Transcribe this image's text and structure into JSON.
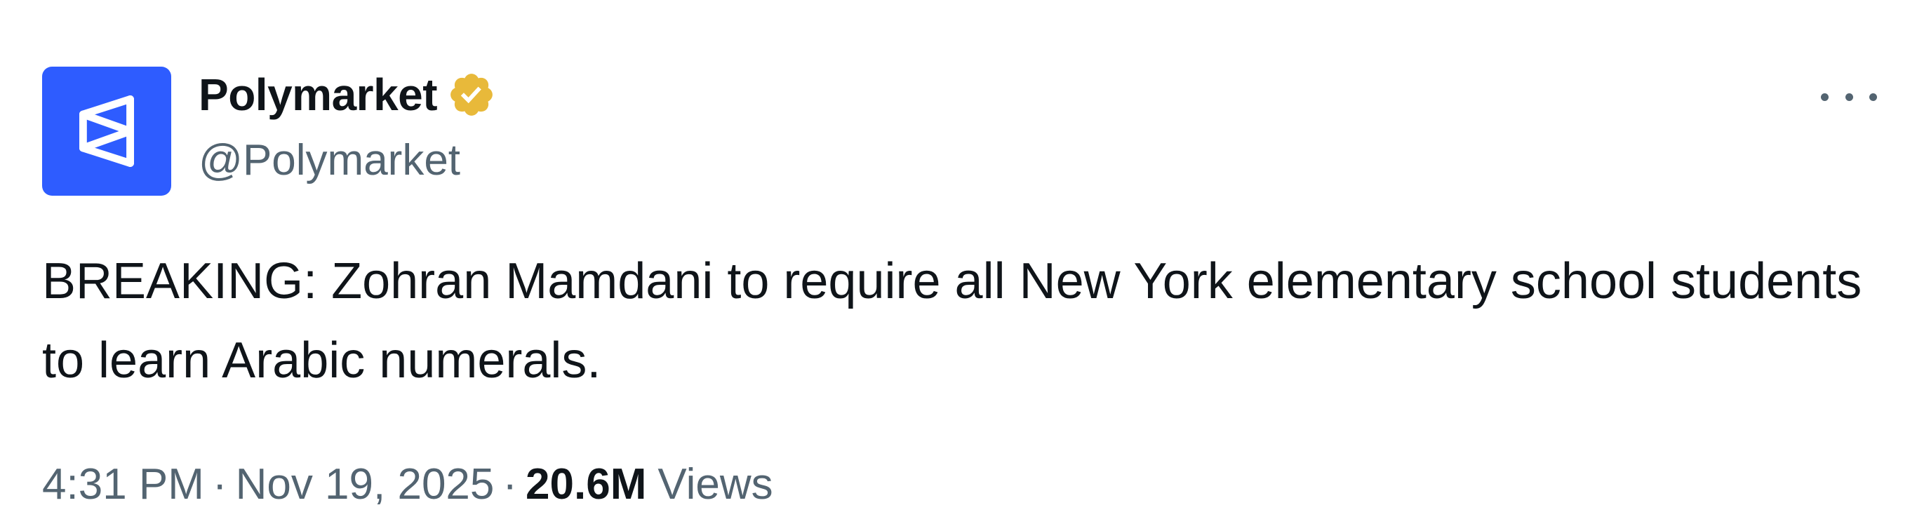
{
  "author": {
    "display_name": "Polymarket",
    "handle": "@Polymarket",
    "verified": true,
    "avatar_color": "#2e5cff",
    "badge_color": "#e8b93a"
  },
  "tweet": {
    "text": "BREAKING: Zohran Mamdani to require all New York elementary school students to learn Arabic numerals."
  },
  "meta": {
    "time": "4:31 PM",
    "separator": "·",
    "date": "Nov 19, 2025",
    "views_count": "20.6M",
    "views_label": "Views"
  },
  "icons": {
    "avatar_logo": "polymarket-logo-icon",
    "verified": "verified-badge-icon",
    "more": "more-options-icon"
  }
}
